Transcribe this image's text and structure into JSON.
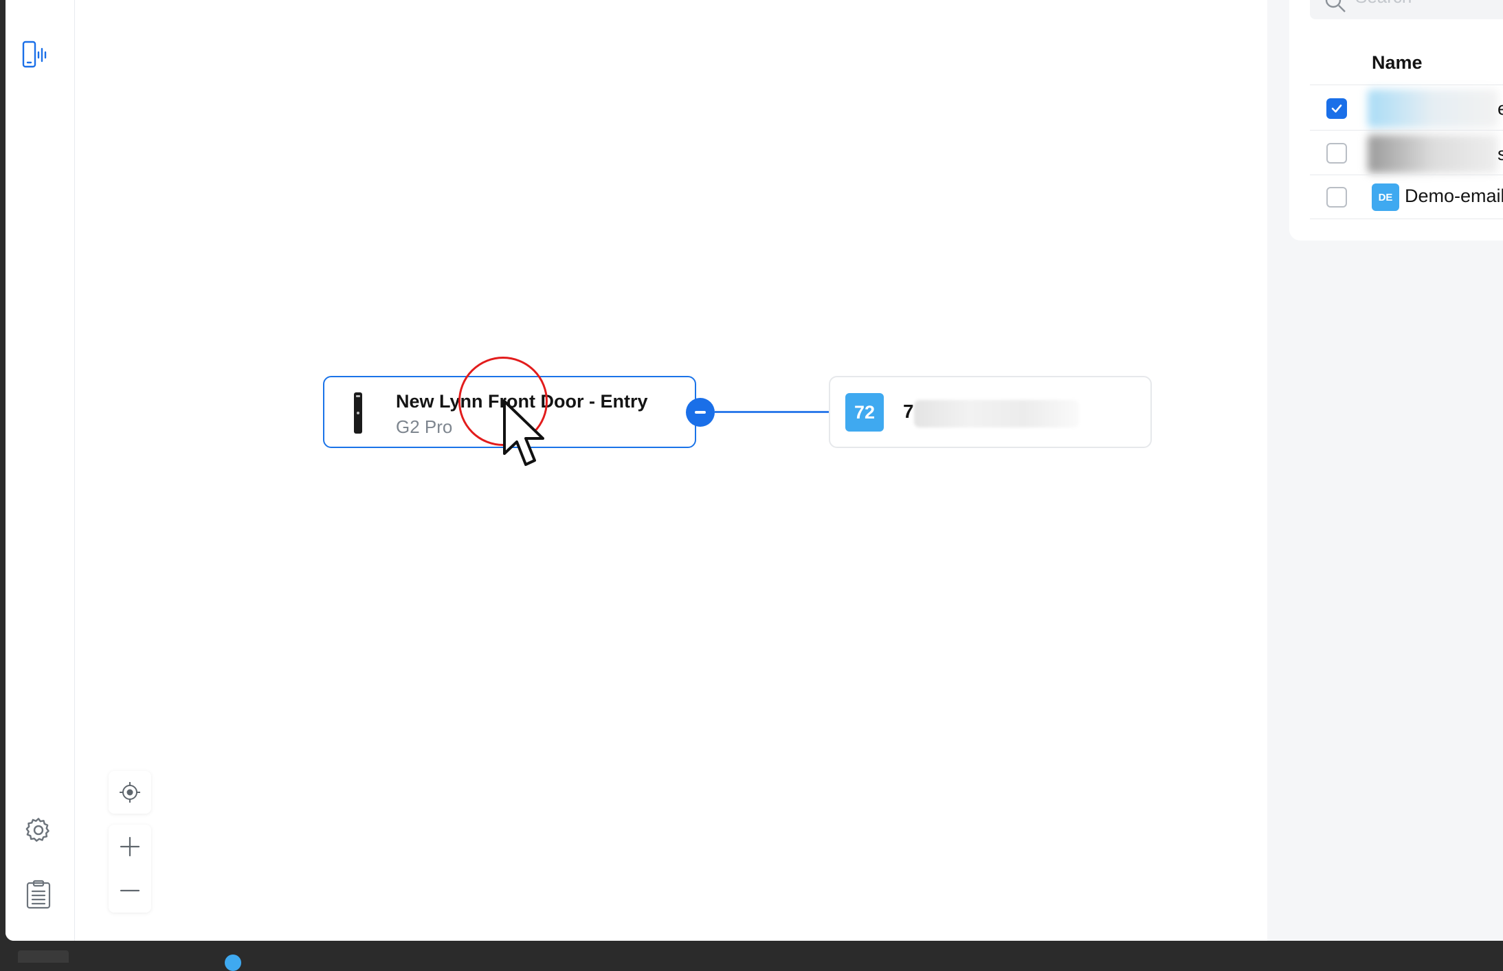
{
  "rail": {
    "top_icon": "intercom-phone-icon",
    "bottom_icons": [
      "gear-icon",
      "clipboard-list-icon"
    ]
  },
  "canvas": {
    "device_node": {
      "title": "New Lynn Front Door - Entry",
      "subtitle": "G2 Pro",
      "icon": "doorbell-device-icon"
    },
    "target_node": {
      "badge": "72",
      "name_visible": "7"
    },
    "controls": [
      "recenter-icon",
      "zoom-in-icon",
      "zoom-out-icon"
    ]
  },
  "panel": {
    "search_placeholder": "Search",
    "column_header": "Name",
    "rows": [
      {
        "checked": true,
        "trailing_text": "e"
      },
      {
        "checked": false,
        "trailing_text": "s"
      },
      {
        "checked": false,
        "badge": "DE",
        "name": "Demo-email"
      }
    ]
  },
  "colors": {
    "accent": "#1a6fe8",
    "badge": "#3fa9f0",
    "cursor_ring": "#e21c1c"
  }
}
